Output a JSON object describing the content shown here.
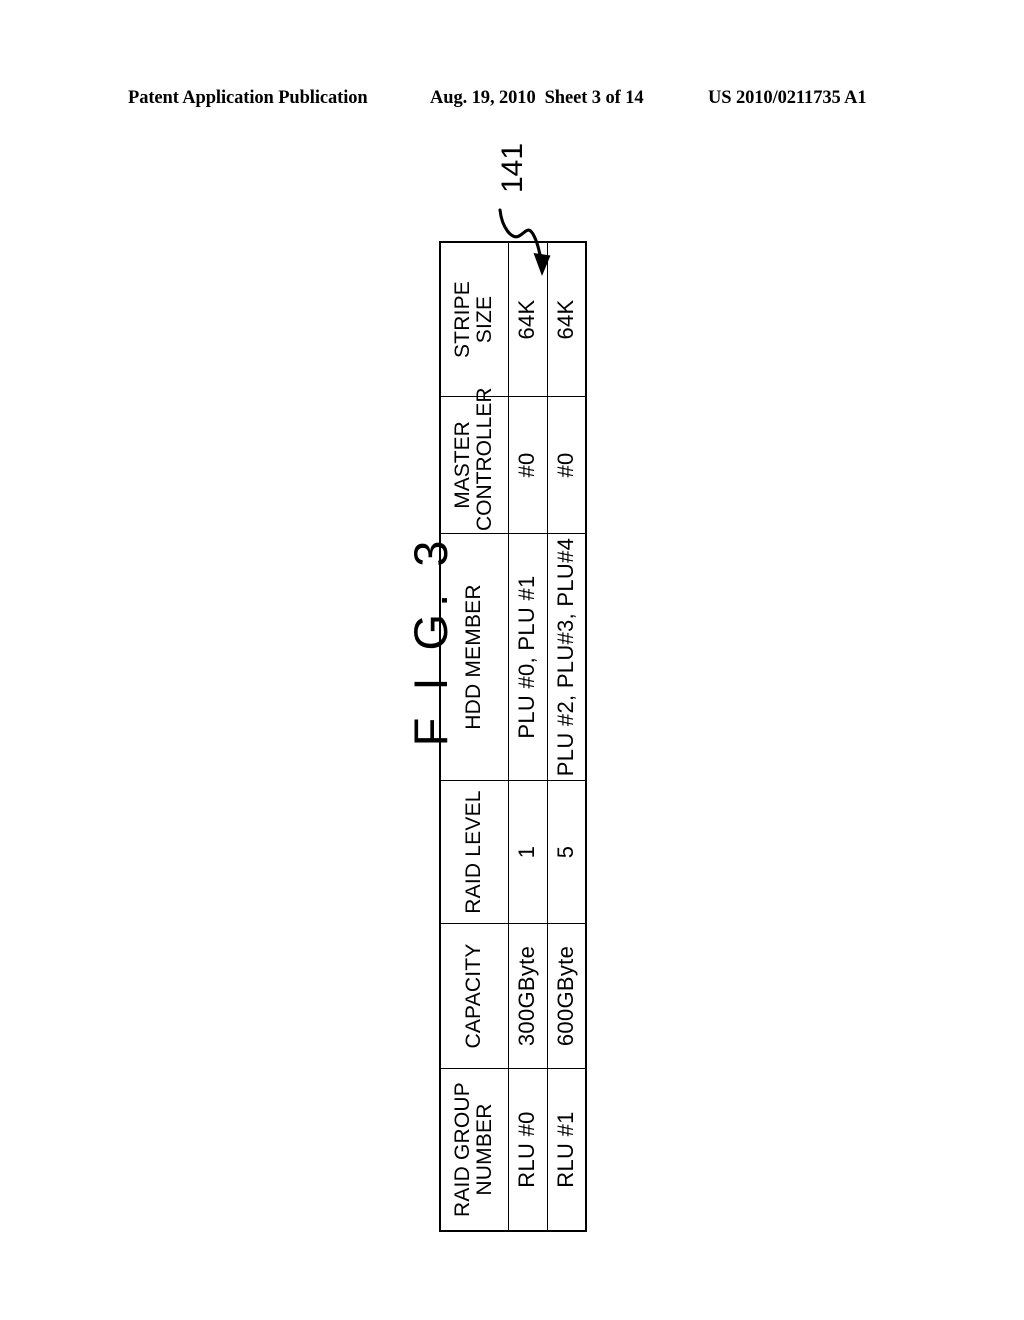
{
  "page_header": {
    "left": "Patent Application Publication",
    "date": "Aug. 19, 2010",
    "sheet": "Sheet 3 of 14",
    "publication_number": "US 2010/0211735 A1"
  },
  "figure": {
    "label": "F I G. 3",
    "reference_numeral": "141",
    "arrow_icon": "curved-arrow-icon"
  },
  "table": {
    "columns": [
      {
        "line1": "RAID GROUP",
        "line2": "NUMBER"
      },
      {
        "line1": "CAPACITY",
        "line2": ""
      },
      {
        "line1": "RAID LEVEL",
        "line2": ""
      },
      {
        "line1": "HDD  MEMBER",
        "line2": ""
      },
      {
        "line1": "MASTER",
        "line2": "CONTROLLER"
      },
      {
        "line1": "STRIPE",
        "line2": "SIZE"
      }
    ],
    "rows": [
      {
        "raid_group_number": "RLU #0",
        "capacity": "300GByte",
        "raid_level": "1",
        "hdd_member": "PLU #0, PLU #1",
        "master_controller": "#0",
        "stripe_size": "64K"
      },
      {
        "raid_group_number": "RLU #1",
        "capacity": "600GByte",
        "raid_level": "5",
        "hdd_member": "PLU #2, PLU#3, PLU#4",
        "master_controller": "#0",
        "stripe_size": "64K"
      }
    ]
  },
  "colors": {
    "ink": "#000000",
    "paper": "#ffffff"
  }
}
